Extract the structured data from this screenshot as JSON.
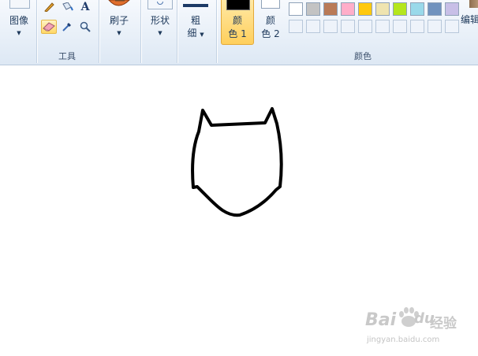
{
  "ribbon": {
    "image_label": "图像",
    "tools_group_label": "工具",
    "brush_label": "刷子",
    "shapes_label": "形状",
    "size_label_line1": "粗",
    "size_label_line2": "细",
    "color1_line1": "颜",
    "color1_line2": "色 1",
    "color2_line1": "颜",
    "color2_line2": "色 2",
    "colors_group_label": "颜色",
    "edit_colors_label": "编辑",
    "text_tool_glyph": "A"
  },
  "palette": {
    "row1": [
      "#ffffff",
      "#c3c3c3",
      "#b97a57",
      "#ffaec9",
      "#ffc90e",
      "#efe4b0",
      "#b5e61d",
      "#99d9ea",
      "#7092be",
      "#c8bfe7"
    ],
    "color1": "#000000",
    "color2": "#ffffff"
  },
  "watermark": {
    "brand": "Bai",
    "brand2": "du",
    "cn": "经验",
    "url": "jingyan.baidu.com"
  }
}
